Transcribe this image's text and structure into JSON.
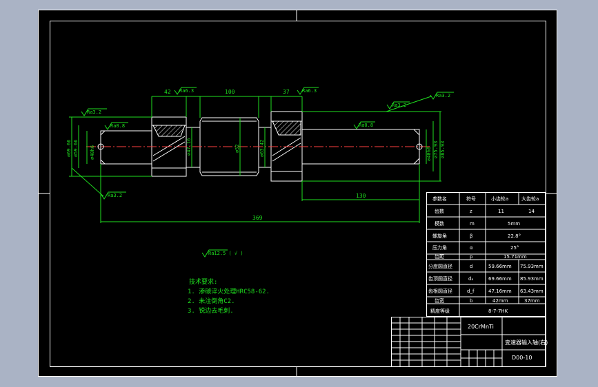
{
  "drawing": {
    "dimensions": {
      "d42": "42",
      "d100": "100",
      "d37": "37",
      "d130": "130",
      "d369": "369",
      "dia_left_outer": "⌀69.66",
      "dia_left_pitch": "⌀59.66",
      "dia_left_neck": "⌀40h6",
      "dia_gear1_root": "⌀47.16",
      "dia_mid": "⌀52",
      "dia_gear2_root": "⌀63.42",
      "dia_right_outer": "⌀75.93",
      "dia_right_root": "⌀85.93",
      "dia_right_neck": "⌀40h6"
    },
    "roughness": {
      "top_left": "Ra6.3",
      "top_right": "Ra6.3",
      "left_face": "Ra3.2",
      "left_bore": "Ra0.8",
      "right_bore": "Ra0.8",
      "right_face": "Ra3.2",
      "right_top": "Ra3.2",
      "bottom_left": "Ra3.2",
      "general": "Ra12.5 ( √ )"
    },
    "notes": {
      "title": "技术要求:",
      "items": [
        "1. 渗碳淬火处理HRC58-62.",
        "2. 未注倒角C2.",
        "3. 锐边去毛刺."
      ]
    }
  },
  "parameter_table": {
    "headers": [
      "参数名",
      "符号",
      "小齿轮a",
      "大齿轮a"
    ],
    "rows": [
      [
        "齿数",
        "z",
        "11",
        "14"
      ],
      [
        "模数",
        "m",
        "5mm",
        ""
      ],
      [
        "螺旋角",
        "β",
        "22.8°",
        ""
      ],
      [
        "压力角",
        "α",
        "25°",
        ""
      ],
      [
        "齿距",
        "p",
        "15.71mm",
        ""
      ],
      [
        "分度圆直径",
        "d",
        "59.66mm",
        "75.93mm"
      ],
      [
        "齿顶圆直径",
        "dₐ",
        "69.66mm",
        "85.93mm"
      ],
      [
        "齿根圆直径",
        "d_f",
        "47.16mm",
        "63.43mm"
      ],
      [
        "齿宽",
        "b",
        "42mm",
        "37mm"
      ],
      [
        "精度等级",
        "",
        "8-7-7HK",
        ""
      ]
    ]
  },
  "title_block": {
    "material": "20CrMnTi",
    "part_name": "变速器输入轴(右)",
    "drawing_no": "D00-10"
  }
}
